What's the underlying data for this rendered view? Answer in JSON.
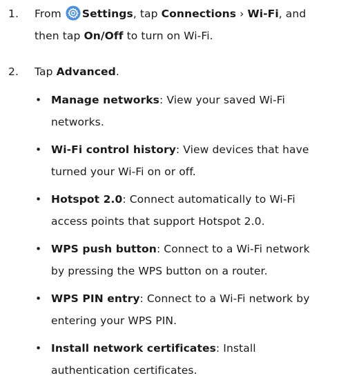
{
  "steps": [
    {
      "number": "1.",
      "line1": {
        "pre": "From ",
        "settings": "Settings",
        "mid1": ", tap ",
        "connections": "Connections",
        "chev": " › ",
        "wifi": "Wi-Fi",
        "post": ", and"
      },
      "line2": {
        "pre": "then tap ",
        "onoff": "On/Off",
        "post": " to turn on Wi-Fi."
      }
    },
    {
      "number": "2.",
      "line1": {
        "pre": "Tap ",
        "advanced": "Advanced",
        "post": "."
      }
    }
  ],
  "bullets": [
    {
      "term": "Manage networks",
      "line1": ": View your saved Wi-Fi",
      "line2": "networks."
    },
    {
      "term": "Wi-Fi control history",
      "line1": ": View devices that have",
      "line2": "turned your Wi-Fi on or off."
    },
    {
      "term": "Hotspot 2.0",
      "line1": ": Connect automatically to Wi-Fi",
      "line2": "access points that support Hotspot 2.0."
    },
    {
      "term": "WPS push button",
      "line1": ": Connect to a Wi-Fi network",
      "line2": "by pressing the WPS button on a router."
    },
    {
      "term": "WPS PIN entry",
      "line1": ": Connect to a Wi-Fi network by",
      "line2": "entering your WPS PIN."
    },
    {
      "term": "Install network certificates",
      "line1": ": Install",
      "line2": "authentication certificates."
    }
  ],
  "bullet_char": "•",
  "icons": {
    "settings": "settings-gear-icon"
  },
  "colors": {
    "settings_icon_bg": "#4a8fe0",
    "text": "#1a1a1a"
  }
}
